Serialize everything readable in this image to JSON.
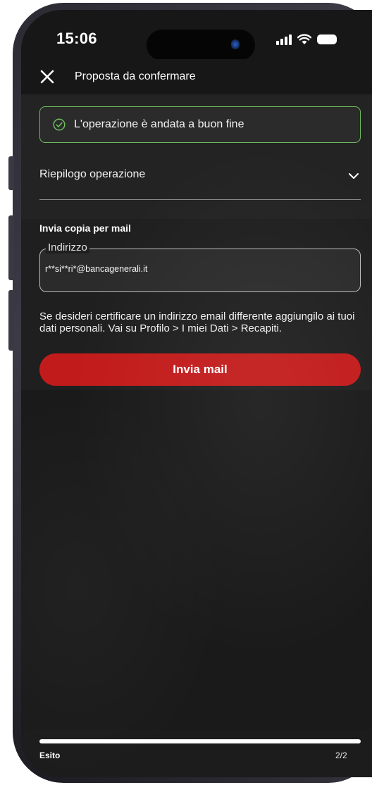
{
  "status_bar": {
    "time": "15:06"
  },
  "header": {
    "close_icon": "close-icon",
    "title": "Proposta da confermare"
  },
  "success_banner": {
    "icon": "check-circle-icon",
    "text": "L'operazione è andata a buon fine",
    "border_color": "#6dbd5e"
  },
  "summary": {
    "label": "Riepilogo operazione",
    "icon": "chevron-down-icon"
  },
  "mail": {
    "title": "Invia copia per mail",
    "address_label": "Indirizzo",
    "address_value": "r**si**ri*@bancagenerali.it",
    "info": "Se desideri certificare un indirizzo email differente aggiungilo ai tuoi dati personali. Vai su Profilo > I miei Dati > Recapiti.",
    "button_label": "Invia mail",
    "button_color": "#c21b1b"
  },
  "progress": {
    "step_label": "Esito",
    "step_count": "2/2",
    "fraction": 1.0
  }
}
